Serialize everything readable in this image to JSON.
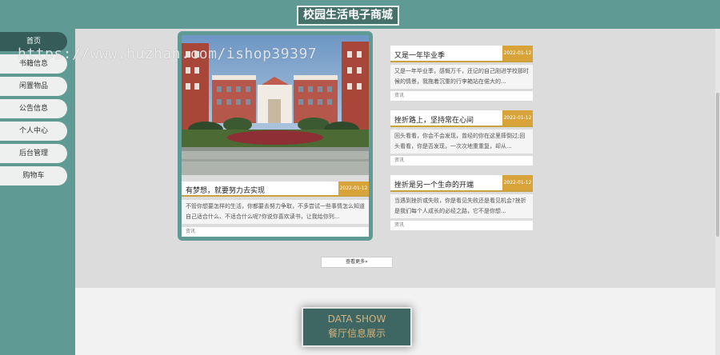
{
  "header": {
    "title": "校园生活电子商城"
  },
  "sidebar": {
    "items": [
      {
        "label": "首页"
      },
      {
        "label": "书籍信息"
      },
      {
        "label": "闲置物品"
      },
      {
        "label": "公告信息"
      },
      {
        "label": "个人中心"
      },
      {
        "label": "后台管理"
      },
      {
        "label": "购物车"
      }
    ]
  },
  "featured": {
    "title": "有梦想，就要努力去实现",
    "date": "2022-01-12",
    "desc": "不管你想要怎样的生活，你都要去努力争取，不多尝试一些事情怎么知道自己适合什么、不适合什么呢?你说你喜欢读书，让我给你列...",
    "tag": "资讯"
  },
  "news": [
    {
      "title": "又是一年毕业季",
      "date": "2022-01-12",
      "desc": "又是一年毕业季，感慨万千，还记的自己刚进学校那时候的情景，我拖着沉重的行李箱站在偌大的...",
      "tag": "资讯"
    },
    {
      "title": "挫折路上，坚持常在心间",
      "date": "2022-01-12",
      "desc": "回头看看，你会不会发现，曾经的你在这里摔倒过;回头看看，你是否发现，一次次地重重复，却从...",
      "tag": "资讯"
    },
    {
      "title": "挫折是另一个生命的开端",
      "date": "2022-01-12",
      "desc": "当遇到挫折或失败，你是看见失败还是看见机会?挫折是我们每个人成长的必经之路，它不是你想...",
      "tag": "资讯"
    }
  ],
  "more_button": {
    "label": "查看更多»"
  },
  "data_show": {
    "en": "DATA SHOW",
    "cn": "餐厅信息展示"
  },
  "watermark": {
    "text": "https://www.huzhan.com/ishop39397"
  }
}
